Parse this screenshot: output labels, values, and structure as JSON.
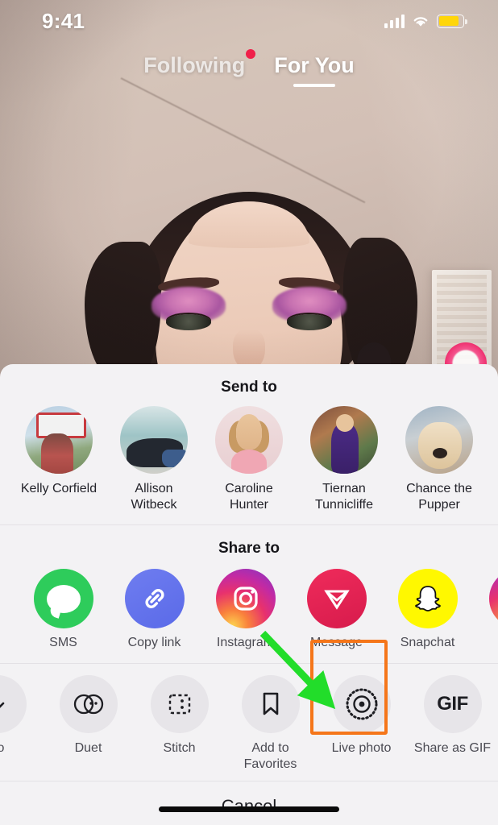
{
  "status_bar": {
    "time": "9:41",
    "signal_icon": "cellular-signal-icon",
    "signal_bars": 4,
    "wifi_icon": "wifi-icon",
    "battery_icon": "battery-icon",
    "battery_color": "#ffd60a",
    "battery_level_percent": 85
  },
  "feed_tabs": {
    "items": [
      {
        "label": "Following",
        "active": false,
        "badge_dot": true,
        "badge_color": "#f0204a"
      },
      {
        "label": "For You",
        "active": true,
        "badge_dot": false
      }
    ]
  },
  "share_sheet": {
    "send_to": {
      "title": "Send to",
      "contacts": [
        {
          "name": "Kelly Corfield",
          "avatar": "avatar-kelly-corfield"
        },
        {
          "name": "Allison Witbeck",
          "avatar": "avatar-allison-witbeck"
        },
        {
          "name": "Caroline Hunter",
          "avatar": "avatar-caroline-hunter"
        },
        {
          "name": "Tiernan Tunnicliffe",
          "avatar": "avatar-tiernan-tunnicliffe"
        },
        {
          "name": "Chance the Pupper",
          "avatar": "avatar-chance-the-pupper"
        }
      ]
    },
    "share_to": {
      "title": "Share to",
      "apps": [
        {
          "label": "SMS",
          "icon": "sms-message-bubble-icon",
          "color": "#2ecc5b"
        },
        {
          "label": "Copy link",
          "icon": "chain-link-icon",
          "color": "#6f7df0"
        },
        {
          "label": "Instagram",
          "icon": "instagram-camera-icon",
          "color": "#e8316d"
        },
        {
          "label": "Message",
          "icon": "paper-plane-icon",
          "color": "#ef2b5b"
        },
        {
          "label": "Snapchat",
          "icon": "snapchat-ghost-icon",
          "color": "#fff800"
        },
        {
          "label": "",
          "icon": "instagram-story-icon",
          "color": "#b42cb0"
        }
      ]
    },
    "actions": [
      {
        "label": "eo",
        "icon": "save-video-icon",
        "partial": true
      },
      {
        "label": "Duet",
        "icon": "duet-circles-icon",
        "partial": false
      },
      {
        "label": "Stitch",
        "icon": "stitch-frame-icon",
        "partial": false
      },
      {
        "label": "Add to Favorites",
        "icon": "bookmark-icon",
        "partial": false
      },
      {
        "label": "Live photo",
        "icon": "live-photo-icon",
        "partial": false,
        "highlighted": true
      },
      {
        "label": "Share as GIF",
        "icon": "gif-text-icon",
        "partial": false
      }
    ],
    "cancel_label": "Cancel"
  },
  "annotation": {
    "highlight_color": "#f5761a",
    "arrow_color": "#22dd2a",
    "target_label": "Live photo"
  },
  "home_indicator": "home-indicator"
}
